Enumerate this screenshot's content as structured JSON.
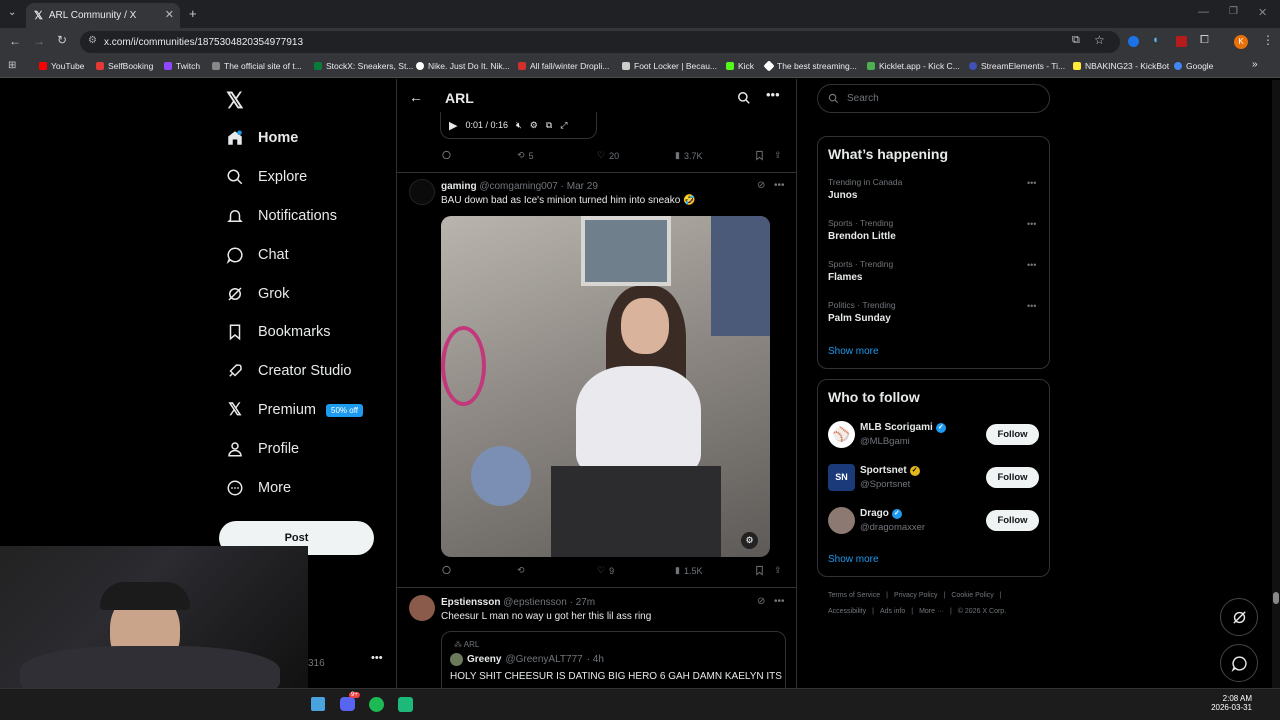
{
  "browser": {
    "tab_title": "ARL Community / X",
    "url": "x.com/i/communities/1875304820354977913",
    "bookmarks": [
      {
        "label": "YouTube",
        "color": "#ff0000"
      },
      {
        "label": "SelfBooking",
        "color": "#e53935"
      },
      {
        "label": "Twitch",
        "color": "#9146ff"
      },
      {
        "label": "The official site of t...",
        "color": "#888888"
      },
      {
        "label": "StockX: Sneakers, St...",
        "color": "#0a7a3a"
      },
      {
        "label": "Nike. Just Do It. Nik...",
        "color": "#ffffff"
      },
      {
        "label": "All fall/winter Dropli...",
        "color": "#d32f2f"
      },
      {
        "label": "Foot Locker | Becau...",
        "color": "#cccccc"
      },
      {
        "label": "Kick",
        "color": "#53fc18"
      },
      {
        "label": "The best streaming...",
        "color": "#ffffff"
      },
      {
        "label": "Kicklet.app - Kick C...",
        "color": "#4caf50"
      },
      {
        "label": "StreamElements - Ti...",
        "color": "#3f51b5"
      },
      {
        "label": "NBAKING23 - KickBot",
        "color": "#ffeb3b"
      },
      {
        "label": "Google",
        "color": "#4285f4"
      }
    ]
  },
  "nav": {
    "items": [
      {
        "label": "Home"
      },
      {
        "label": "Explore"
      },
      {
        "label": "Notifications"
      },
      {
        "label": "Chat"
      },
      {
        "label": "Grok"
      },
      {
        "label": "Bookmarks"
      },
      {
        "label": "Creator Studio"
      },
      {
        "label": "Premium"
      },
      {
        "label": "Profile"
      },
      {
        "label": "More"
      }
    ],
    "premium_badge": "50% off",
    "post_label": "Post",
    "hidden_count": "316"
  },
  "feed": {
    "title": "ARL",
    "video": {
      "time": "0:01 / 0:16"
    },
    "tweet0": {
      "replies": "",
      "retweets": "5",
      "likes": "20",
      "views": "3.7K"
    },
    "tweet1": {
      "name": "gaming",
      "handle": "@comgaming007",
      "date": "· Mar 29",
      "text": "BAU down bad as Ice's minion turned him into sneako 🤣",
      "replies": "",
      "retweets": "",
      "likes": "9",
      "views": "1.5K"
    },
    "tweet2": {
      "name": "Epstiensson",
      "handle": "@epstiensson",
      "date": "· 27m",
      "text": "Cheesur L man no way u got her this lil ass ring",
      "quote": {
        "community": "ARL",
        "name": "Greeny",
        "handle": "@GreenyALT777",
        "date": "· 4h",
        "text": "HOLY SHIT CHEESUR IS DATING BIG HERO 6 GAH DAMN KAELYN ITS"
      }
    }
  },
  "right": {
    "search_placeholder": "Search",
    "happening": {
      "title": "What’s happening",
      "trends": [
        {
          "context": "Trending in Canada",
          "name": "Junos"
        },
        {
          "context": "Sports · Trending",
          "name": "Brendon Little"
        },
        {
          "context": "Sports · Trending",
          "name": "Flames"
        },
        {
          "context": "Politics · Trending",
          "name": "Palm Sunday"
        }
      ],
      "show_more": "Show more"
    },
    "who": {
      "title": "Who to follow",
      "accounts": [
        {
          "name": "MLB Scorigami",
          "handle": "@MLBgami",
          "verified": "#1d9bf0"
        },
        {
          "name": "Sportsnet",
          "handle": "@Sportsnet",
          "verified": "#e2b719"
        },
        {
          "name": "Drago",
          "handle": "@dragomaxxer",
          "verified": "#1d9bf0"
        }
      ],
      "follow_label": "Follow",
      "show_more": "Show more"
    },
    "footer": {
      "l1": [
        "Terms of Service",
        "Privacy Policy",
        "Cookie Policy"
      ],
      "l2": [
        "Accessibility",
        "Ads info",
        "More ···",
        "© 2026 X Corp."
      ]
    }
  },
  "taskbar": {
    "time": "2:08 AM",
    "date": "2026-03-31",
    "discord_badge": "9+"
  }
}
